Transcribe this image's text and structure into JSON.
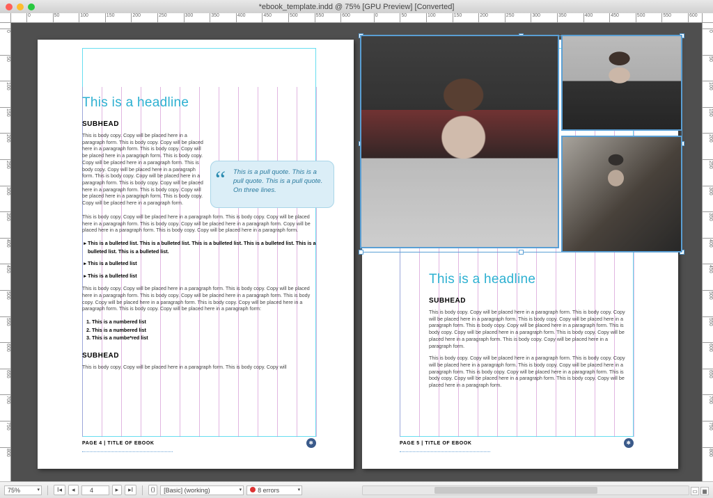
{
  "window": {
    "title": "*ebook_template.indd @ 75% [GPU Preview] [Converted]"
  },
  "ruler": {
    "h_ticks": [
      "0",
      "50",
      "100",
      "150",
      "200",
      "250",
      "300",
      "350",
      "400",
      "450",
      "500",
      "550",
      "600",
      "0",
      "50",
      "100",
      "150",
      "200",
      "250",
      "300",
      "350",
      "400",
      "450",
      "500",
      "550",
      "600"
    ],
    "v_ticks": [
      "0",
      "50",
      "100",
      "150",
      "200",
      "250",
      "300",
      "350",
      "400",
      "450",
      "500",
      "550",
      "600",
      "650",
      "700",
      "750",
      "800"
    ]
  },
  "page4": {
    "headline": "This is a headline",
    "subhead1": "SUBHEAD",
    "para1": "This is body copy. Copy will be placed here in a paragraph form. This is body copy. Copy will be placed here in a paragraph form. This is body copy. Copy will be placed here in a paragraph form. This is body copy. Copy will be placed here in a paragraph form. This is body copy. Copy will be placed here in a paragraph form. This is body copy. Copy will be placed here in a paragraph form. This is body copy. Copy will be placed here in a paragraph form. This is body copy. Copy will be placed here in a paragraph form. This is body copy. Copy will be placed here in a paragraph form.",
    "pullquote": "This is a pull quote. This is a pull quote. This is a pull quote. On three lines.",
    "para2": "This is body copy. Copy will be placed here in a paragraph form. This is body copy. Copy will be placed here in a paragraph form. This is body copy. Copy will be placed here in a paragraph form. Copy will be placed here in a paragraph form. This is body copy. Copy will be placed here in a paragraph form.",
    "bullets": [
      "This is a bulleted list. This is a bulleted list. This is a bulleted list. This is a bulleted list. This is a bulleted list. This is a bulleted list.",
      "This is a bulleted list",
      "This is a bulleted list"
    ],
    "para3": "This is body copy. Copy will be placed here in a paragraph form. This is body copy. Copy will be placed here in a paragraph form. This is body copy. Copy will be placed here in a paragraph form. This is body copy. Copy will be placed here in a paragraph form. This is body copy. Copy will be placed here in a paragraph form. This is body copy. Copy will be placed here in a paragraph form:",
    "numlist": [
      "This is a numbered list",
      "This is a numbered list",
      "This is a numbe*red list"
    ],
    "subhead2": "SUBHEAD",
    "para4": "This is body copy. Copy will be placed here in a paragraph form. This is body copy. Copy will",
    "footer": "PAGE 4  |  TITLE OF EBOOK"
  },
  "page5": {
    "headline": "This is a headline",
    "subhead": "SUBHEAD",
    "para1": "This is body copy. Copy will be placed here in a paragraph form. This is body copy. Copy will be placed here in a paragraph form. This is body copy. Copy will be placed here in a paragraph form. This is body copy. Copy will be placed here in a paragraph form. This is body copy. Copy will be placed here in a paragraph form. This is body copy. Copy will be placed here in a paragraph form. This is body copy. Copy will be placed here in a paragraph form.",
    "para2": "This is body copy. Copy will be placed here in a paragraph form. This is body copy. Copy will be placed here in a paragraph form. This is body copy. Copy will be placed here in a paragraph form. This is body copy. Copy will be placed here in a paragraph form. This is body copy. Copy will be placed here in a paragraph form. This is body copy. Copy will be placed here in a paragraph form.",
    "footer": "PAGE 5  |  TITLE OF EBOOK"
  },
  "statusbar": {
    "zoom": "75%",
    "page_nav": "4",
    "preflight_profile": "[Basic] (working)",
    "errors": "8 errors"
  },
  "colors": {
    "headline": "#2db0d1",
    "guide_magenta": "#d278c8",
    "guide_cyan": "#00c8e6",
    "selection": "#5a9fd4"
  }
}
